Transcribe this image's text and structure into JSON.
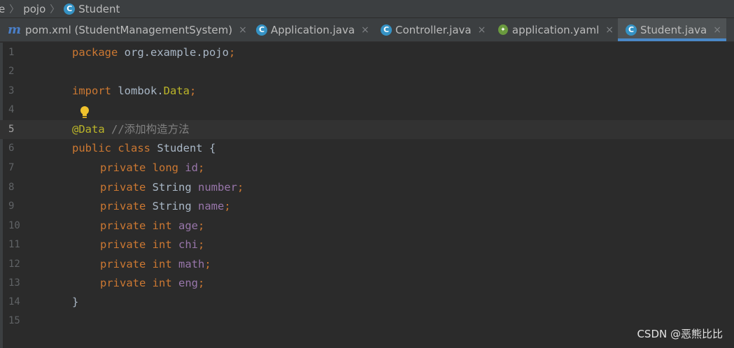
{
  "breadcrumb": {
    "items": [
      "e",
      "pojo",
      "Student"
    ]
  },
  "tabs": [
    {
      "label": "pom.xml (StudentManagementSystem)",
      "icon": "maven-icon",
      "active": false
    },
    {
      "label": "Application.java",
      "icon": "class-icon",
      "active": false
    },
    {
      "label": "Controller.java",
      "icon": "class-icon",
      "active": false
    },
    {
      "label": "application.yaml",
      "icon": "yaml-icon",
      "active": false
    },
    {
      "label": "Student.java",
      "icon": "class-icon",
      "active": true
    }
  ],
  "close_glyph": "×",
  "class_icon_letter": "C",
  "maven_icon_letter": "m",
  "editor": {
    "current_line": 5,
    "line_numbers": [
      "1",
      "2",
      "3",
      "4",
      "5",
      "6",
      "7",
      "8",
      "9",
      "10",
      "11",
      "12",
      "13",
      "14",
      "15"
    ],
    "lines": {
      "l1": {
        "kw": "package",
        "rest": " org.example.pojo",
        "semi": ";"
      },
      "l3": {
        "kw": "import",
        "rest": " lombok.",
        "cls": "Data",
        "semi": ";"
      },
      "l5": {
        "ann": "@Data",
        "comment": " //添加构造方法"
      },
      "l6": {
        "kw": "public class",
        "rest": " Student {"
      },
      "fields": [
        {
          "mod": "private",
          "type": "long",
          "type_is_kw": true,
          "name": "id"
        },
        {
          "mod": "private",
          "type": "String",
          "type_is_kw": false,
          "name": "number"
        },
        {
          "mod": "private",
          "type": "String",
          "type_is_kw": false,
          "name": "name"
        },
        {
          "mod": "private",
          "type": "int",
          "type_is_kw": true,
          "name": "age"
        },
        {
          "mod": "private",
          "type": "int",
          "type_is_kw": true,
          "name": "chi"
        },
        {
          "mod": "private",
          "type": "int",
          "type_is_kw": true,
          "name": "math"
        },
        {
          "mod": "private",
          "type": "int",
          "type_is_kw": true,
          "name": "eng"
        }
      ],
      "l14": {
        "text": "}"
      }
    },
    "semicolon": ";"
  },
  "watermark": "CSDN @恶熊比比",
  "colors": {
    "keyword": "#cc7832",
    "annotation": "#bbb529",
    "field": "#9876aa",
    "comment": "#808080",
    "text": "#a9b7c6",
    "accent": "#4a88c7"
  }
}
